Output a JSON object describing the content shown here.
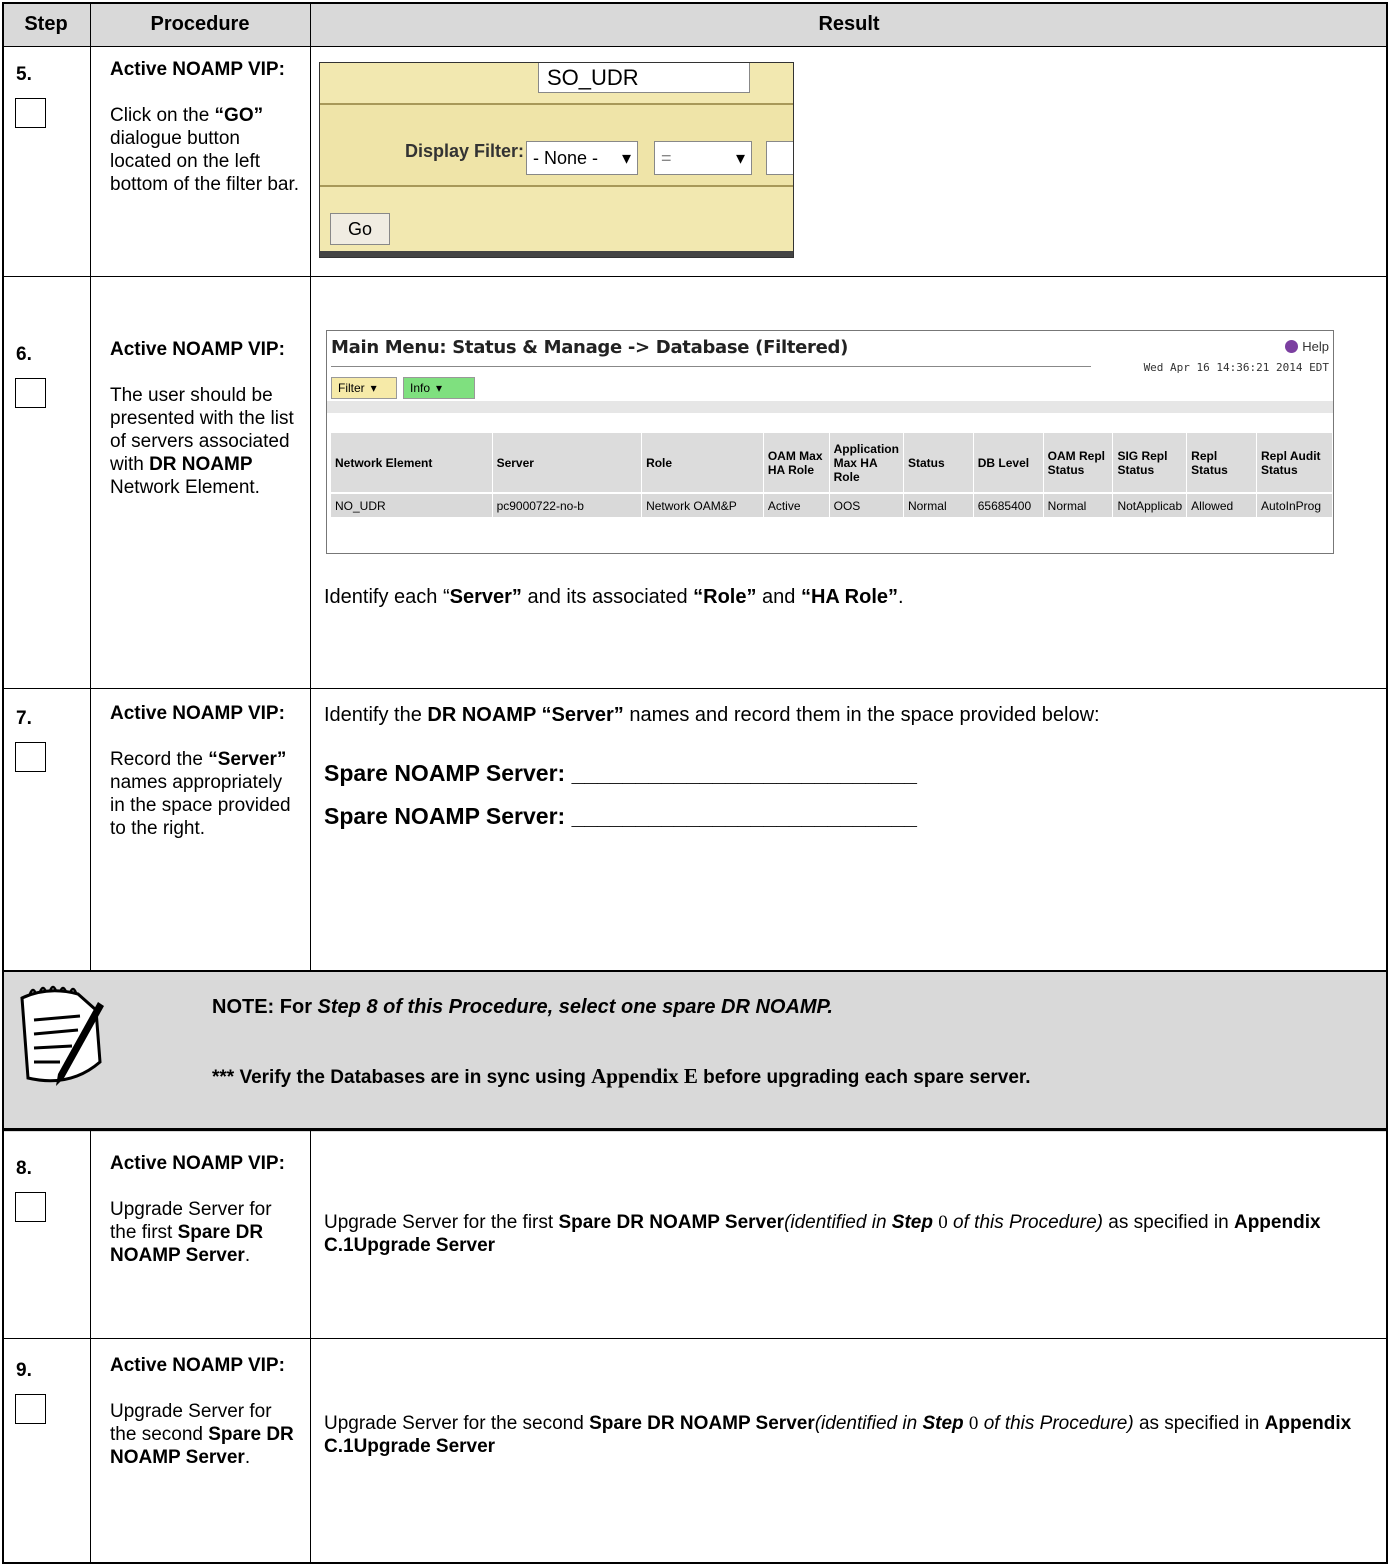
{
  "headers": {
    "step": "Step",
    "procedure": "Procedure",
    "result": "Result"
  },
  "steps": {
    "s5": {
      "number": "5.",
      "proc_title": "Active NOAMP VIP:",
      "proc_a": "Click on the ",
      "proc_b": "“GO”",
      "proc_c": " dialogue button located on the left bottom of the filter bar.",
      "screenshot": {
        "field_value": "SO_UDR",
        "display_filter_label": "Display Filter:",
        "select1_value": "- None -",
        "select2_value": "=",
        "go_label": "Go"
      }
    },
    "s6": {
      "number": "6.",
      "proc_title": "Active NOAMP VIP:",
      "proc_a": "The user should be presented with the list of servers associated with ",
      "proc_b": "DR NOAMP",
      "proc_c": " Network Element.",
      "screenshot": {
        "title": "Main Menu: Status & Manage -> Database (Filtered)",
        "help": "Help",
        "timestamp": "Wed Apr 16 14:36:21 2014 EDT",
        "filter_btn": "Filter",
        "info_btn": "Info",
        "columns": [
          "Network Element",
          "Server",
          "Role",
          "OAM Max HA Role",
          "Application Max HA Role",
          "Status",
          "DB Level",
          "OAM Repl Status",
          "SIG Repl Status",
          "Repl Status",
          "Repl Audit Status"
        ],
        "row": [
          "NO_UDR",
          "pc9000722-no-b",
          "Network OAM&P",
          "Active",
          "OOS",
          "Normal",
          "65685400",
          "Normal",
          "NotApplicab",
          "Allowed",
          "AutoInProg"
        ]
      },
      "result_a": "Identify each “",
      "result_b": "Server”",
      "result_c": " and its associated ",
      "result_d": "“Role”",
      "result_e": " and ",
      "result_f": "“HA Role”",
      "result_g": "."
    },
    "s7": {
      "number": "7.",
      "proc_title": "Active NOAMP VIP:",
      "proc_a": "Record the ",
      "proc_b": "“Server”",
      "proc_c": " names appropriately in the space provided to the right.",
      "result_a": "Identify the ",
      "result_b": "DR NOAMP “Server”",
      "result_c": " names and record them in the space provided below:",
      "line1": "Spare NOAMP Server: ___________________________",
      "line2": "Spare NOAMP Server: ___________________________"
    },
    "note": {
      "prefix": "NOTE:  For ",
      "emph": "Step 8 of this Procedure, select one spare DR NOAMP.",
      "line2_a": "*** Verify the Databases are in sync using ",
      "line2_b": "Appendix E",
      "line2_c": " before upgrading each spare server."
    },
    "s8": {
      "number": "8.",
      "proc_title": "Active NOAMP VIP:",
      "proc_a": "Upgrade Server for the first ",
      "proc_b": "Spare DR NOAMP Server",
      "proc_c": ".",
      "result_a": "Upgrade Server for the first ",
      "result_b": "Spare DR NOAMP Server",
      "result_c": "(identified in ",
      "result_d": "Step",
      "result_e": "0",
      "result_f": " of this Procedure)",
      "result_g": " as specified in ",
      "result_h": "Appendix C.1Upgrade Server"
    },
    "s9": {
      "number": "9.",
      "proc_title": "Active NOAMP VIP:",
      "proc_a": "Upgrade Server for the second ",
      "proc_b": "Spare DR NOAMP Server",
      "proc_c": ".",
      "result_a": "Upgrade Server for the second ",
      "result_b": "Spare DR NOAMP Server",
      "result_c": "(identified in ",
      "result_d": "Step",
      "result_e": "0",
      "result_f": " of this Procedure)",
      "result_g": " as specified in ",
      "result_h": "Appendix C.1Upgrade Server"
    }
  }
}
